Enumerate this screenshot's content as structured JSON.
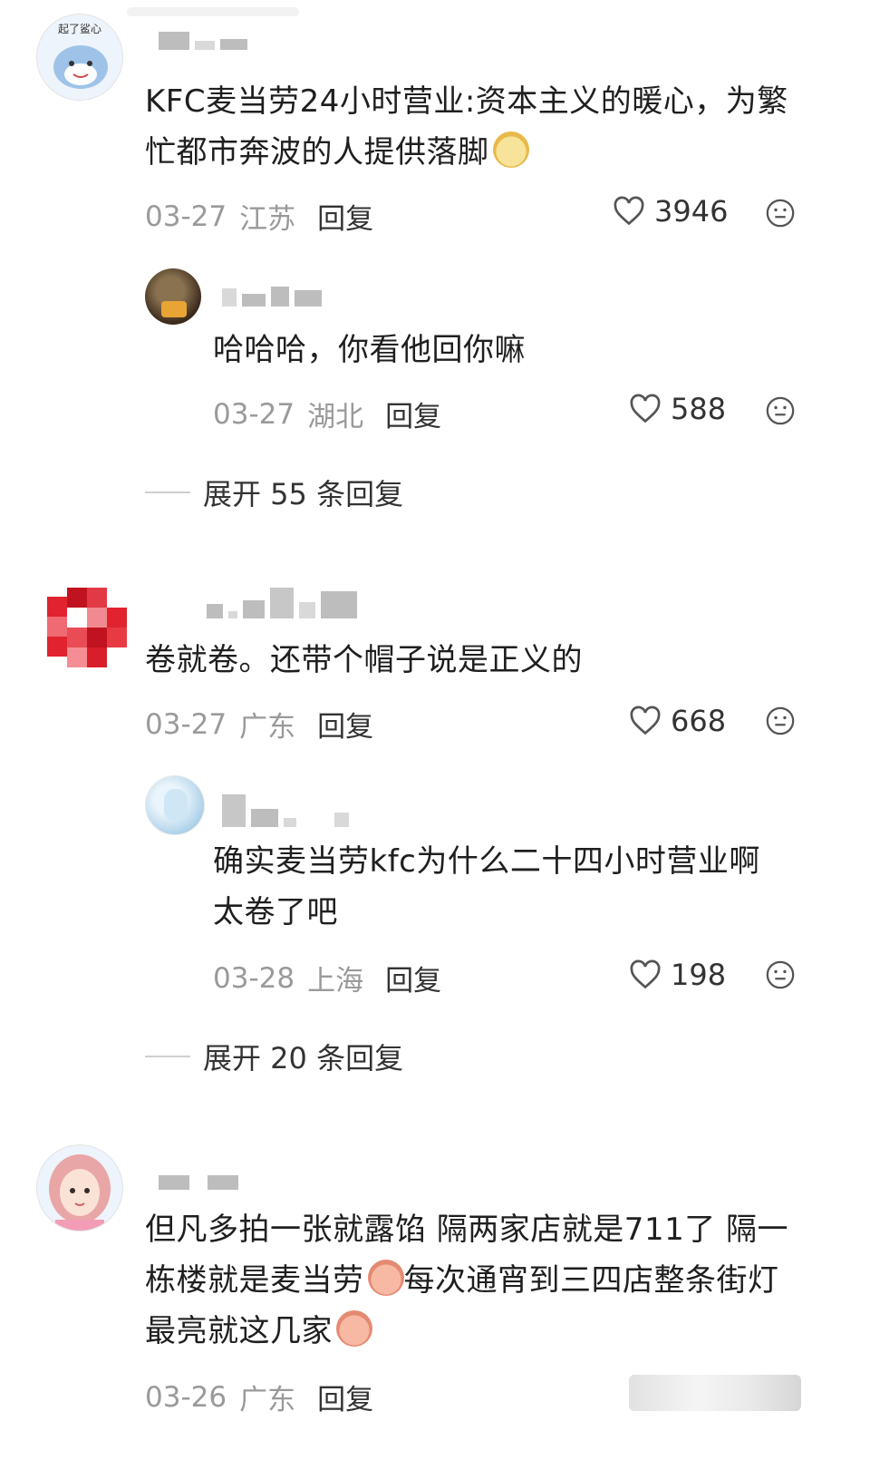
{
  "comments": [
    {
      "text_lines": [
        "KFC麦当劳24小时营业:资本主义的暖心，为繁",
        "忙都市奔波的人提供落脚"
      ],
      "avatar_badge": "起了鲨心",
      "date": "03-27",
      "location": "江苏",
      "reply_label": "回复",
      "likes": "3946",
      "emoji": "smiling-fruit-emoji",
      "replies": [
        {
          "text_lines": [
            "哈哈哈，你看他回你嘛"
          ],
          "date": "03-27",
          "location": "湖北",
          "reply_label": "回复",
          "likes": "588"
        }
      ],
      "expand_label": "展开 55 条回复"
    },
    {
      "text_lines": [
        "卷就卷。还带个帽子说是正义的"
      ],
      "date": "03-27",
      "location": "广东",
      "reply_label": "回复",
      "likes": "668",
      "replies": [
        {
          "text_lines": [
            "确实麦当劳kfc为什么二十四小时营业啊",
            "太卷了吧"
          ],
          "date": "03-28",
          "location": "上海",
          "reply_label": "回复",
          "likes": "198"
        }
      ],
      "expand_label": "展开 20 条回复"
    },
    {
      "text_lines": [
        "但凡多拍一张就露馅 隔两家店就是711了 隔一",
        "栋楼就是麦当劳",
        "每次通宵到三四店整条街灯",
        "最亮就这几家"
      ],
      "date": "03-26",
      "location": "广东",
      "reply_label": "回复"
    }
  ],
  "colors": {
    "text": "#1f1f1f",
    "meta": "#9a9a9a",
    "blur": "#bdbdbd",
    "divider": "#cfcfcf"
  },
  "icons": {
    "like": "heart-outline-icon",
    "dislike": "neutral-face-icon"
  }
}
